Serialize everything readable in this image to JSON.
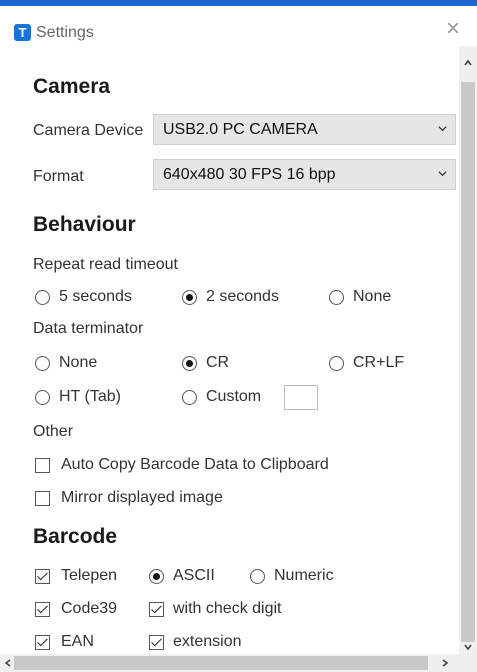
{
  "window": {
    "title": "Settings",
    "app_icon_letter": "T"
  },
  "camera": {
    "heading": "Camera",
    "device_label": "Camera Device",
    "device_value": "USB2.0 PC CAMERA",
    "format_label": "Format",
    "format_value": "640x480 30 FPS 16 bpp"
  },
  "behaviour": {
    "heading": "Behaviour",
    "repeat_label": "Repeat read timeout",
    "repeat_options": [
      "5 seconds",
      "2 seconds",
      "None"
    ],
    "repeat_selected": "2 seconds",
    "terminator_label": "Data terminator",
    "terminator_options": [
      "None",
      "CR",
      "CR+LF",
      "HT (Tab)",
      "Custom"
    ],
    "terminator_selected": "CR",
    "custom_value": "",
    "other_label": "Other",
    "auto_copy_label": "Auto Copy Barcode Data to Clipboard",
    "auto_copy_checked": false,
    "mirror_label": "Mirror displayed image",
    "mirror_checked": false
  },
  "barcode": {
    "heading": "Barcode",
    "telepen_label": "Telepen",
    "telepen_checked": true,
    "telepen_modes": [
      "ASCII",
      "Numeric"
    ],
    "telepen_mode_selected": "ASCII",
    "code39_label": "Code39",
    "code39_checked": true,
    "code39_check_digit_label": "with check digit",
    "code39_check_digit_checked": true,
    "ean_label": "EAN",
    "ean_checked": true,
    "ean_extension_label": "extension",
    "ean_extension_checked": true
  },
  "icons": {
    "close": "close-icon",
    "dropdown": "chevron-down-icon",
    "scroll_up": "chevron-up-icon",
    "scroll_down": "chevron-down-icon",
    "scroll_left": "chevron-left-icon",
    "scroll_right": "chevron-right-icon"
  },
  "colors": {
    "accent": "#1e66d0",
    "app_icon": "#1a73d9",
    "dropdown_bg": "#e6e6e6"
  }
}
